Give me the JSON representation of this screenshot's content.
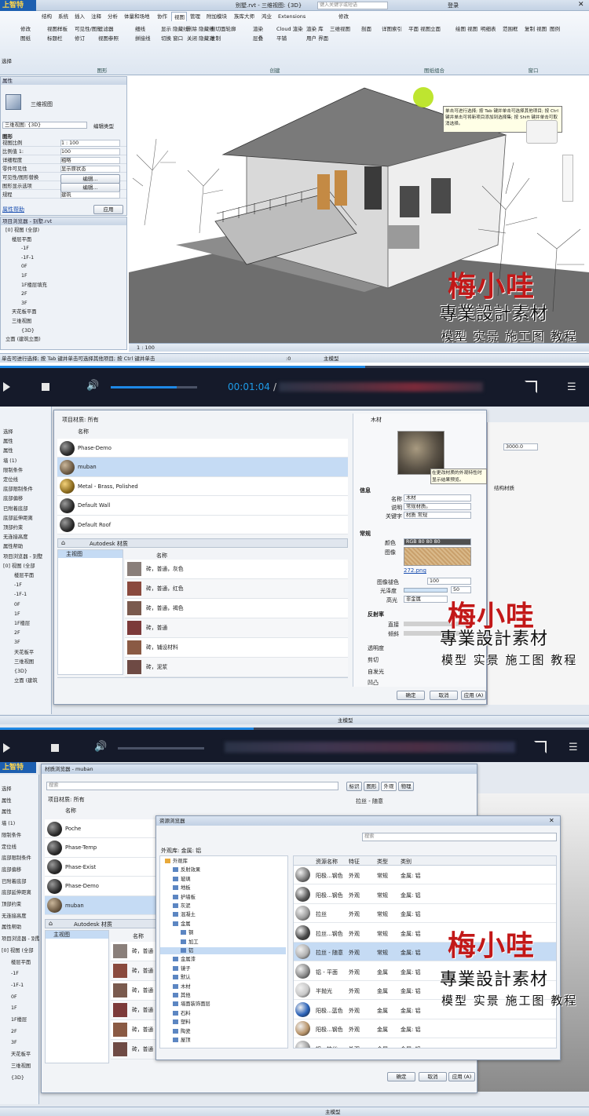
{
  "app": {
    "brand": "上智特",
    "window_title": "别墅.rvt - 三维视图: {3D}",
    "search_placeholder": "键入关键字或短语",
    "user": "登录",
    "tabs": [
      "结构",
      "系统",
      "插入",
      "注释",
      "分析",
      "体量和场地",
      "协作",
      "视图",
      "管理",
      "附加模块",
      "族库大师",
      "鸿业",
      "Extensions",
      "修改"
    ],
    "active_tab": "视图",
    "ribbon_groups": [
      "图形",
      "创建",
      "图纸组合",
      "窗口"
    ],
    "ribbon_items": [
      "修改",
      "视图样板",
      "可见性/图形",
      "过滤器",
      "细线",
      "显示 隐藏线",
      "删除 隐藏线",
      "剖切面轮廓",
      "渲染",
      "Cloud 渲染",
      "渲染 库",
      "三维视图",
      "剖面",
      "详图索引",
      "平面 视图",
      "立面",
      "绘图 视图",
      "明细表",
      "范围框",
      "复制 视图",
      "图例",
      "图纸",
      "标题栏",
      "修订",
      "视图参照",
      "拼接线",
      "切换 窗口",
      "关闭 隐藏对象",
      "复制",
      "层叠",
      "平铺",
      "用户 界面"
    ],
    "select_label": "选择",
    "properties": {
      "title": "属性",
      "type_label": "三维视图",
      "view_selector": "三维视图: {3D}",
      "edit_type": "编辑类型",
      "section": "图形",
      "rows": [
        [
          "视图比例",
          "1 : 100"
        ],
        [
          "比例值 1:",
          "100"
        ],
        [
          "详细程度",
          "粗略"
        ],
        [
          "零件可见性",
          "显示原状态"
        ],
        [
          "可见性/图形替换",
          "编辑..."
        ],
        [
          "图形显示选项",
          "编辑..."
        ],
        [
          "规程",
          "建筑"
        ]
      ],
      "help": "属性帮助",
      "apply": "应用"
    },
    "browser": {
      "title": "项目浏览器 - 别墅.rvt",
      "items": [
        "[0] 视图 (全部)",
        "楼层平面",
        "-1F",
        "-1F-1",
        "0F",
        "1F",
        "1F楼层填充",
        "2F",
        "3F",
        "天花板平面",
        "三维视图",
        "{3D}",
        "立面 (建筑立面)"
      ]
    },
    "tooltip": "单击可进行选择; 按 Tab 键并单击可选择其他项目; 按 Ctrl 键并单击可将新项目添加到选择集; 按 Shift 键并单击可取消选择。",
    "view_scale": "1 : 100",
    "status_text": "单击可进行选择; 按 Tab 键并单击可选择其他项目; 按 Ctrl 键并单击",
    "status_model": "主模型",
    "status_zero": ":0"
  },
  "player1": {
    "time": "00:01:04",
    "separator": "/",
    "progress": 0.62
  },
  "player2": {
    "progress": 0.43
  },
  "material_dialog1": {
    "project_label": "项目材质: 所有",
    "column_name": "名称",
    "materials": [
      "Phase-Demo",
      "muban",
      "Metal - Brass, Polished",
      "Default Wall",
      "Default Roof"
    ],
    "selected": "muban",
    "library_label": "Autodesk 材质",
    "library_root": "主视图",
    "library_column": "名称",
    "library_items": [
      "砖，普通，灰色",
      "砖，普通，红色",
      "砖，普通，褐色",
      "砖，普通",
      "砖，铺设材料",
      "砖，泥浆"
    ],
    "asset_name": "木材",
    "preview_tip": "在更改材质的外观特性时显示结果预览。",
    "info_section": "信息",
    "info_rows": [
      [
        "名称",
        "木材"
      ],
      [
        "说明",
        "常规材质。"
      ],
      [
        "关键字",
        "材质 常规"
      ]
    ],
    "general_section": "常规",
    "color_label": "颜色",
    "color_value": "RGB 80 80 80",
    "image_label": "图像",
    "image_file": "272.png",
    "fade_label": "图像褪色",
    "fade_value": "100",
    "gloss_label": "光泽度",
    "gloss_value": "50",
    "highlight_label": "高光",
    "highlight_value": "非金属",
    "reflect_section": "反射率",
    "direct_label": "直接",
    "oblique_label": "倾斜",
    "sections": [
      "透明度",
      "剪切",
      "自发光",
      "凹凸"
    ],
    "buttons": [
      "确定",
      "取消",
      "应用 (A)"
    ],
    "side_value": "3000.0",
    "side_column": "结构材质",
    "side_tree": [
      "选择",
      "属性",
      "属性",
      "墙 (1)",
      "限制条件",
      "定位线",
      "底部限制条件",
      "底部偏移",
      "已附着底部",
      "底部延伸距离",
      "顶部约束",
      "无连接高度",
      "属性帮助",
      "项目浏览器 - 别墅",
      "[0] 视图 (全部",
      "楼层平面",
      "-1F",
      "-1F-1",
      "0F",
      "1F",
      "1F楼层",
      "2F",
      "3F",
      "天花板平",
      "三维视图",
      "{3D}",
      "立面 (建筑"
    ]
  },
  "material_dialog2": {
    "title": "材质浏览器 - muban",
    "search_placeholder": "搜索",
    "tabs": [
      "标识",
      "图形",
      "外观",
      "物理"
    ],
    "asset_name": "拉丝 - 随意",
    "project_label": "项目材质: 所有",
    "column_name": "名称",
    "materials": [
      "Poche",
      "Phase-Temp",
      "Phase-Exist",
      "Phase-Demo",
      "muban"
    ],
    "library_label": "Autodesk 材质",
    "library_root": "主视图",
    "library_column": "名称",
    "library_items": [
      "砖，普通",
      "砖，普通",
      "砖，普通",
      "砖，普通",
      "砖，普通",
      "砖，普通"
    ],
    "buttons": [
      "确定",
      "取消",
      "应用 (A)"
    ]
  },
  "asset_browser": {
    "title": "资源浏览器",
    "search_placeholder": "搜索",
    "breadcrumb": "外观库: 金属: 铝",
    "tree": [
      "外观库",
      "反射效果",
      "玻璃",
      "地板",
      "护墙板",
      "灰泥",
      "混凝土",
      "金属",
      "钢",
      "加工",
      "铝",
      "金属漆",
      "镜子",
      "默认",
      "木材",
      "其他",
      "墙面装饰面层",
      "石料",
      "塑料",
      "陶瓷",
      "屋顶"
    ],
    "selected_tree": "铝",
    "columns": [
      "资源名称",
      "特征",
      "类型",
      "类别"
    ],
    "rows": [
      [
        "阳极...钢色",
        "外观",
        "常规",
        "金属: 铝"
      ],
      [
        "阳极...钢色",
        "外观",
        "常规",
        "金属: 铝"
      ],
      [
        "拉丝",
        "外观",
        "常规",
        "金属: 铝"
      ],
      [
        "拉丝...钢色",
        "外观",
        "常规",
        "金属: 铝"
      ],
      [
        "拉丝 - 随意",
        "外观",
        "常规",
        "金属: 铝"
      ],
      [
        "铝 - 平面",
        "外观",
        "金属",
        "金属: 铝"
      ],
      [
        "半抛光",
        "外观",
        "金属",
        "金属: 铝"
      ],
      [
        "阳极...蓝色",
        "外观",
        "金属",
        "金属: 铝"
      ],
      [
        "阳极...钢色",
        "外观",
        "金属",
        "金属: 铝"
      ],
      [
        "铝 - 拉丝",
        "外观",
        "金属",
        "金属: 铝"
      ]
    ]
  },
  "watermark": {
    "logo": "梅小哇",
    "line1": "專業設計素材",
    "line2": "模型 实景 施工图 教程"
  },
  "colors": {
    "ribbon": "#dde6f1",
    "player": "#151a2a",
    "accent": "#1e88e5",
    "selected_row": "#c5dbf4",
    "watermark_red": "#c21818"
  }
}
